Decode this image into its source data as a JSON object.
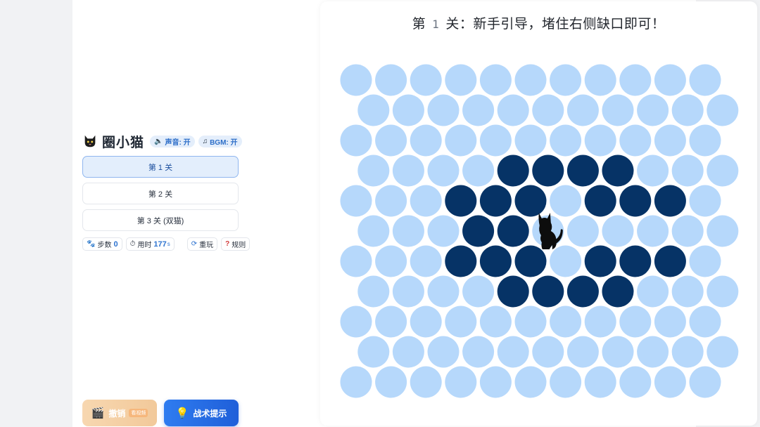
{
  "sidebar": {
    "title": "圈小猫",
    "sound_label": "声音: 开",
    "bgm_label": "BGM: 开",
    "levels": [
      "第 1 关",
      "第 2 关",
      "第 3 关 (双猫)"
    ],
    "active_level": 0,
    "stats": {
      "steps_label": "步数",
      "steps_value": "0",
      "time_label": "用时",
      "time_value": "177",
      "time_unit": "s",
      "replay_label": "重玩",
      "rules_label": "规则"
    },
    "undo_label": "撤销",
    "undo_badge": "看视频",
    "hint_label": "战术提示"
  },
  "board": {
    "title_prefix": "第",
    "level_number": "1",
    "title_suffix": "关：新手引导，堵住右侧缺口即可！",
    "rows": 11,
    "cols": 11,
    "blocked": [
      [
        3,
        4
      ],
      [
        3,
        5
      ],
      [
        3,
        6
      ],
      [
        3,
        7
      ],
      [
        4,
        3
      ],
      [
        4,
        4
      ],
      [
        4,
        5
      ],
      [
        4,
        7
      ],
      [
        4,
        8
      ],
      [
        4,
        9
      ],
      [
        5,
        3
      ],
      [
        5,
        4
      ],
      [
        6,
        3
      ],
      [
        6,
        4
      ],
      [
        6,
        5
      ],
      [
        6,
        7
      ],
      [
        6,
        8
      ],
      [
        6,
        9
      ],
      [
        7,
        4
      ],
      [
        7,
        5
      ],
      [
        7,
        6
      ],
      [
        7,
        7
      ]
    ],
    "cat": [
      5,
      5
    ],
    "colors": {
      "open": "#b6d8fb",
      "blocked": "#063366",
      "cat": "#0d0d0d"
    }
  }
}
